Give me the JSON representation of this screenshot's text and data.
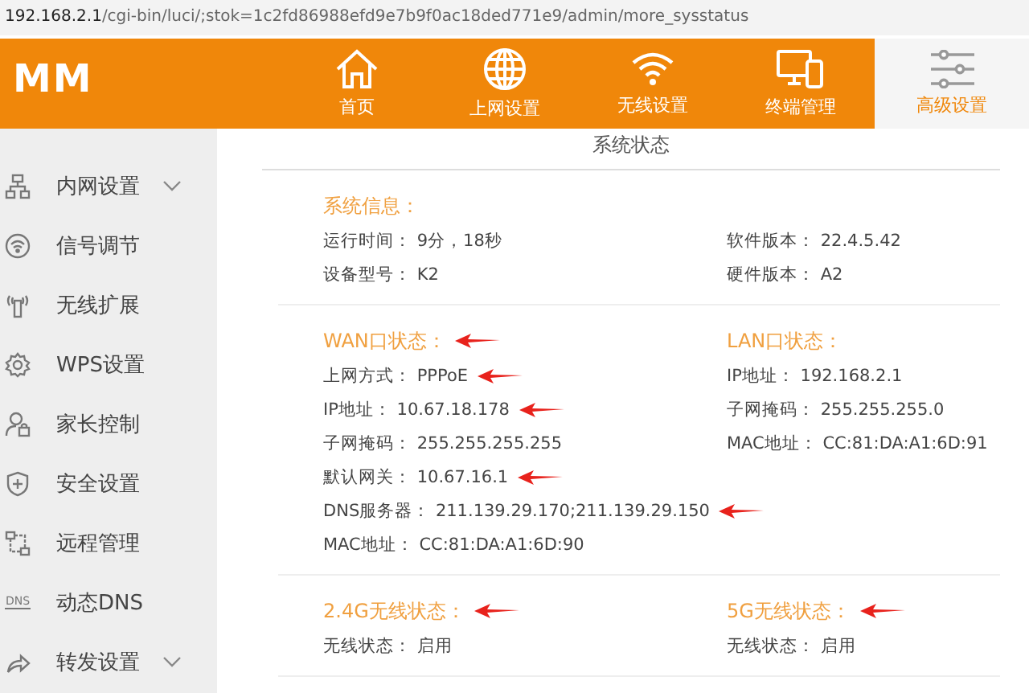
{
  "address_bar": {
    "host": "192.168.2.1",
    "path": "/cgi-bin/luci/;stok=1c2fd86988efd9e7b9f0ac18ded771e9/admin/more_sysstatus"
  },
  "logo": "MM",
  "nav": [
    {
      "label": "首页",
      "selected": false
    },
    {
      "label": "上网设置",
      "selected": false
    },
    {
      "label": "无线设置",
      "selected": false
    },
    {
      "label": "终端管理",
      "selected": false
    },
    {
      "label": "高级设置",
      "selected": true
    }
  ],
  "sidebar": {
    "items": [
      {
        "label": "内网设置",
        "expandable": true
      },
      {
        "label": "信号调节",
        "expandable": false
      },
      {
        "label": "无线扩展",
        "expandable": false
      },
      {
        "label": "WPS设置",
        "expandable": false
      },
      {
        "label": "家长控制",
        "expandable": false
      },
      {
        "label": "安全设置",
        "expandable": false
      },
      {
        "label": "远程管理",
        "expandable": false
      },
      {
        "label": "动态DNS",
        "icon_text": "DNS",
        "expandable": false
      },
      {
        "label": "转发设置",
        "expandable": true
      }
    ]
  },
  "page_title": "系统状态",
  "blocks": [
    {
      "columns": [
        {
          "title": "系统信息：",
          "rows": [
            {
              "label": "运行时间：",
              "value": "9分，18秒"
            },
            {
              "label": "设备型号：",
              "value": "K2"
            }
          ]
        },
        {
          "rows": [
            {
              "label": "软件版本：",
              "value": "22.4.5.42"
            },
            {
              "label": "硬件版本：",
              "value": "A2"
            }
          ]
        }
      ]
    },
    {
      "columns": [
        {
          "title": "WAN口状态：",
          "arrow": true,
          "rows": [
            {
              "label": "上网方式：",
              "value": "PPPoE",
              "arrow": true
            },
            {
              "label": "IP地址：",
              "value": "10.67.18.178",
              "arrow": true
            },
            {
              "label": "子网掩码：",
              "value": "255.255.255.255"
            },
            {
              "label": "默认网关：",
              "value": "10.67.16.1",
              "arrow": true
            },
            {
              "label": "DNS服务器：",
              "value": "211.139.29.170;211.139.29.150",
              "arrow": true
            },
            {
              "label": "MAC地址：",
              "value": "CC:81:DA:A1:6D:90"
            }
          ]
        },
        {
          "title": "LAN口状态：",
          "rows": [
            {
              "label": "IP地址：",
              "value": "192.168.2.1"
            },
            {
              "label": "子网掩码：",
              "value": "255.255.255.0"
            },
            {
              "label": "MAC地址：",
              "value": "CC:81:DA:A1:6D:91"
            }
          ]
        }
      ]
    },
    {
      "columns": [
        {
          "title": "2.4G无线状态：",
          "arrow": true,
          "rows": [
            {
              "label": "无线状态：",
              "value": "启用"
            }
          ]
        },
        {
          "title": "5G无线状态：",
          "arrow": true,
          "rows": [
            {
              "label": "无线状态：",
              "value": "启用"
            }
          ]
        }
      ]
    }
  ]
}
